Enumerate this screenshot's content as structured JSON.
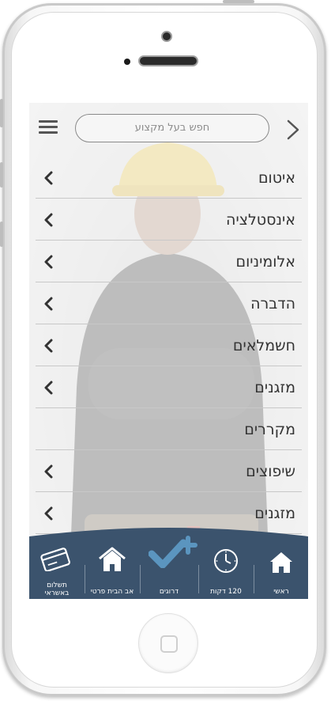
{
  "search": {
    "placeholder": "חפש בעל מקצוע"
  },
  "categories": [
    {
      "label": "איטום",
      "has_chevron": true
    },
    {
      "label": "אינסטלציה",
      "has_chevron": true
    },
    {
      "label": "אלומיניום",
      "has_chevron": true
    },
    {
      "label": "הדברה",
      "has_chevron": true
    },
    {
      "label": "חשמלאים",
      "has_chevron": true
    },
    {
      "label": "מזגנים",
      "has_chevron": true
    },
    {
      "label": "מקררים",
      "has_chevron": false
    },
    {
      "label": "שיפוצים",
      "has_chevron": true
    },
    {
      "label": "מזגנים",
      "has_chevron": true
    }
  ],
  "tabbar": {
    "payment_label_line1": "תשלום",
    "payment_label_line2": "באשראי",
    "private_home_label": "אב הבית פרטי",
    "ratings_label": "דרוגים",
    "minutes_label": "120 דקות",
    "main_label": "ראשי"
  },
  "colors": {
    "tabbar": "#3b536d",
    "accent_check": "#5b95bf"
  },
  "icons": [
    "menu-icon",
    "chevron-right-icon",
    "chevron-left-icon",
    "credit-card-icon",
    "house-icon",
    "checkmark-plus-icon",
    "clock-icon",
    "home-icon"
  ]
}
